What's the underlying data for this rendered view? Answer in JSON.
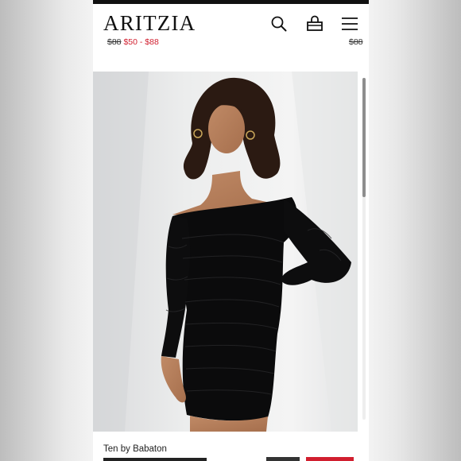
{
  "header": {
    "logo": "ARITZIA",
    "icons": [
      "search-icon",
      "shopping-bag-icon",
      "menu-icon"
    ]
  },
  "peek_prices": {
    "left_original": "$88",
    "left_sale": "$50 - $88",
    "right_original": "$88"
  },
  "product": {
    "brand": "Ten by Babaton",
    "image": "model-in-black-off-shoulder-ruched-mini-dress"
  },
  "colors": {
    "accent_sale": "#d11f2f",
    "text": "#111111"
  }
}
